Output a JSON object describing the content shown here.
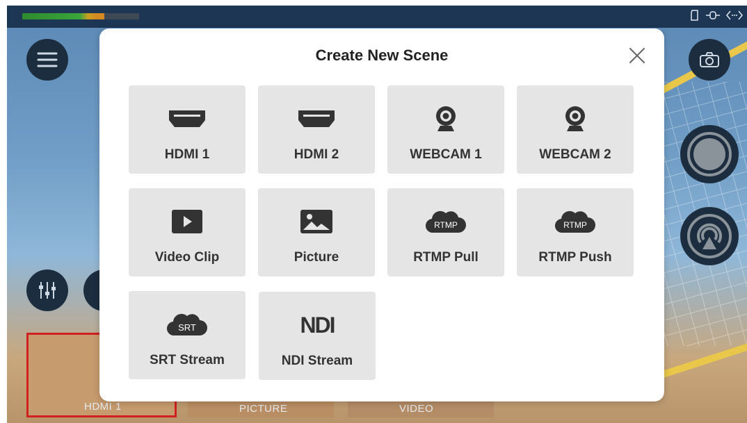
{
  "background": {
    "thumbnails": [
      {
        "label": "HDMI 1",
        "active": true
      },
      {
        "label": "PICTURE",
        "active": false
      },
      {
        "label": "VIDEO",
        "active": false
      }
    ]
  },
  "modal": {
    "title": "Create New Scene",
    "tiles": [
      {
        "label": "HDMI 1",
        "icon": "hdmi-icon"
      },
      {
        "label": "HDMI 2",
        "icon": "hdmi-icon"
      },
      {
        "label": "WEBCAM 1",
        "icon": "webcam-icon"
      },
      {
        "label": "WEBCAM 2",
        "icon": "webcam-icon"
      },
      {
        "label": "Video Clip",
        "icon": "play-icon"
      },
      {
        "label": "Picture",
        "icon": "image-icon"
      },
      {
        "label": "RTMP Pull",
        "icon": "rtmp-cloud-icon",
        "badge": "RTMP"
      },
      {
        "label": "RTMP Push",
        "icon": "rtmp-cloud-icon",
        "badge": "RTMP"
      },
      {
        "label": "SRT Stream",
        "icon": "srt-cloud-icon",
        "badge": "SRT"
      },
      {
        "label": "NDI Stream",
        "icon": "ndi-logo-icon",
        "badge": "NDI"
      }
    ]
  },
  "colors": {
    "tile_bg": "#e5e5e5",
    "icon": "#333333",
    "active_thumb_border": "#d02020"
  }
}
